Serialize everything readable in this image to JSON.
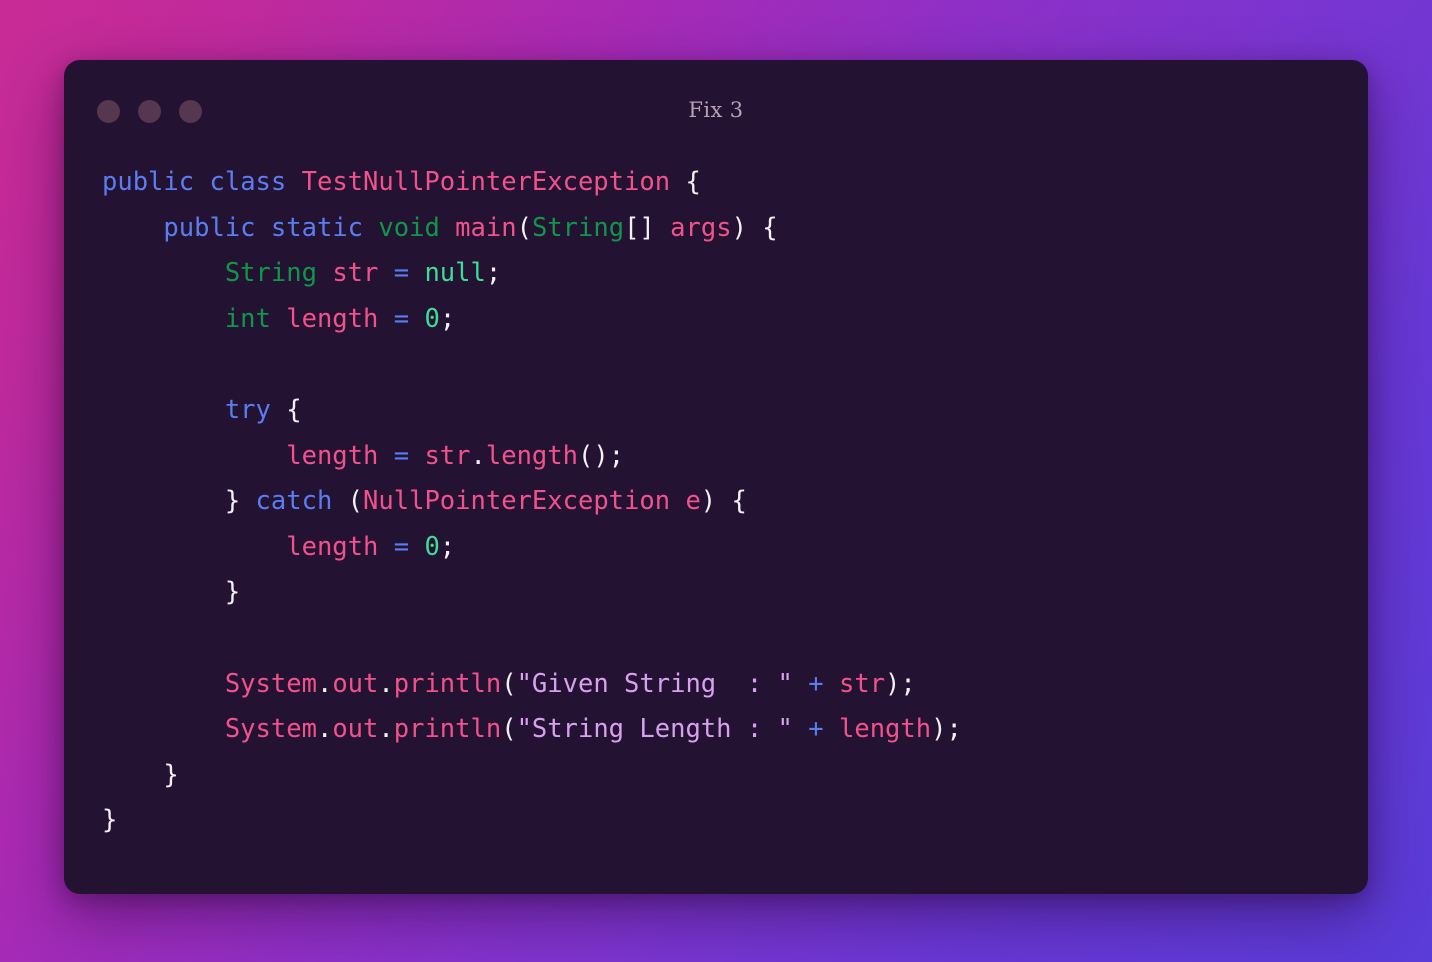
{
  "window": {
    "title": "Fix 3",
    "traffic_lights": [
      "close-dot",
      "minimize-dot",
      "maximize-dot"
    ],
    "panel_color": "#241233",
    "dot_color": "#55374f"
  },
  "background": {
    "gradient_from": "#c92b95",
    "gradient_mid": "#8c30c8",
    "gradient_to": "#5a3cd8"
  },
  "syntax_colors": {
    "keyword": "#5a7df0",
    "type": "#109648",
    "literal": "#3ddc97",
    "identifier": "#f2528c",
    "string": "#d8a0ee",
    "punctuation": "#f3f1f3"
  },
  "code": {
    "language": "java",
    "lines": [
      "public class TestNullPointerException {",
      "    public static void main(String[] args) {",
      "        String str = null;",
      "        int length = 0;",
      "",
      "        try {",
      "            length = str.length();",
      "        } catch (NullPointerException e) {",
      "            length = 0;",
      "        }",
      "",
      "        System.out.println(\"Given String  : \" + str);",
      "        System.out.println(\"String Length : \" + length);",
      "    }",
      "}"
    ],
    "tokens": {
      "l1": {
        "kw1": "public",
        "kw2": "class",
        "cls": "TestNullPointerException",
        "brace": "{"
      },
      "l2": {
        "kw1": "public",
        "kw2": "static",
        "typ": "void",
        "id": "main",
        "par1": "(",
        "arg_type": "String",
        "brackets": "[]",
        "arg": "args",
        "par2": ")",
        "brace": "{"
      },
      "l3": {
        "typ": "String",
        "id": "str",
        "eq": "=",
        "lit": "null",
        "semi": ";"
      },
      "l4": {
        "typ": "int",
        "id": "length",
        "eq": "=",
        "lit": "0",
        "semi": ";"
      },
      "l6": {
        "kw": "try",
        "brace": "{"
      },
      "l7": {
        "id1": "length",
        "eq": "=",
        "id2": "str",
        "dot": ".",
        "id3": "length",
        "parens": "()",
        "semi": ";"
      },
      "l8": {
        "brace1": "}",
        "kw": "catch",
        "par1": "(",
        "exc": "NullPointerException",
        "var": "e",
        "par2": ")",
        "brace2": "{"
      },
      "l9": {
        "id": "length",
        "eq": "=",
        "lit": "0",
        "semi": ";"
      },
      "l10": {
        "brace": "}"
      },
      "l12": {
        "sys": "System",
        "d1": ".",
        "out": "out",
        "d2": ".",
        "println": "println",
        "par1": "(",
        "str_lit": "\"Given String  : \"",
        "plus": "+",
        "id": "str",
        "par2": ")",
        "semi": ";"
      },
      "l13": {
        "sys": "System",
        "d1": ".",
        "out": "out",
        "d2": ".",
        "println": "println",
        "par1": "(",
        "str_lit": "\"String Length : \"",
        "plus": "+",
        "id": "length",
        "par2": ")",
        "semi": ";"
      },
      "l14": {
        "brace": "}"
      },
      "l15": {
        "brace": "}"
      }
    }
  }
}
